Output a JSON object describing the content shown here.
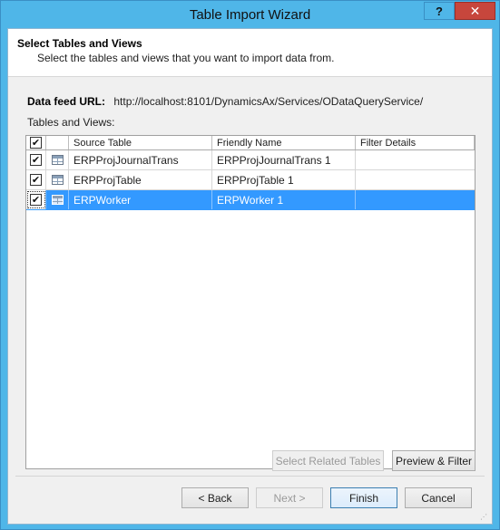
{
  "window": {
    "title": "Table Import Wizard",
    "help_label": "?",
    "close_label": "✕"
  },
  "header": {
    "title": "Select Tables and Views",
    "subtitle": "Select the tables and views that you want to import data from."
  },
  "feed": {
    "label": "Data feed URL:",
    "value": "http://localhost:8101/DynamicsAx/Services/ODataQueryService/"
  },
  "tables_label": "Tables and Views:",
  "grid": {
    "columns": [
      "Source Table",
      "Friendly Name",
      "Filter Details"
    ],
    "header_checked": true,
    "rows": [
      {
        "checked": true,
        "icon": "table-icon",
        "source": "ERPProjJournalTrans",
        "friendly": "ERPProjJournalTrans 1",
        "filter": ""
      },
      {
        "checked": true,
        "icon": "table-icon",
        "source": "ERPProjTable",
        "friendly": "ERPProjTable 1",
        "filter": ""
      },
      {
        "checked": true,
        "icon": "table-icon",
        "source": "ERPWorker",
        "friendly": "ERPWorker 1",
        "filter": "",
        "selected": true
      }
    ]
  },
  "buttons": {
    "select_related": "Select Related Tables",
    "preview_filter": "Preview & Filter",
    "back": "< Back",
    "next": "Next >",
    "finish": "Finish",
    "cancel": "Cancel"
  },
  "colors": {
    "selection": "#3399ff",
    "titlebar": "#4fb6e8",
    "close": "#c7463c"
  }
}
